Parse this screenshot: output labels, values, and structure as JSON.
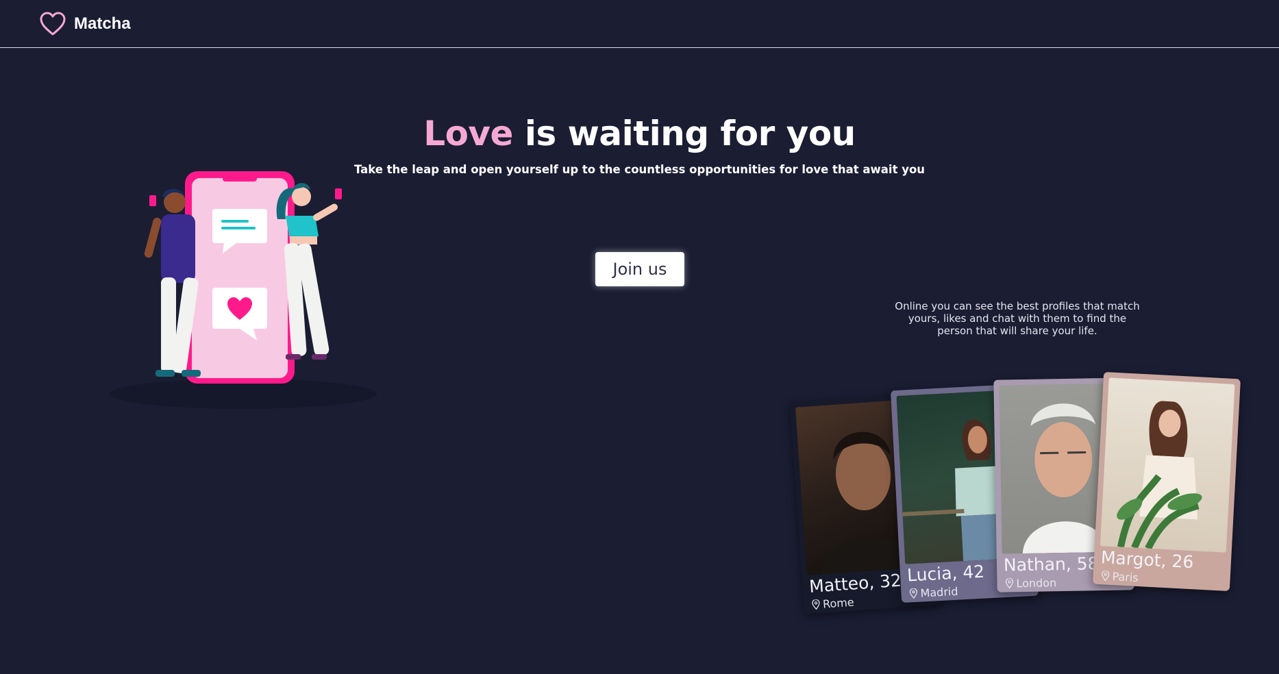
{
  "header": {
    "app_name": "Matcha",
    "logo_icon": "heart-outline-icon"
  },
  "hero": {
    "title_accent": "Love",
    "title_rest": " is waiting for you",
    "subtitle": "Take the leap and open yourself up to the countless opportunities for love that await you",
    "join_label": "Join us"
  },
  "side_text": "Online you can see the best profiles that match yours, likes and chat with them to find the person that will share your life.",
  "profiles": [
    {
      "name": "Matteo, 32",
      "city": "Rome"
    },
    {
      "name": "Lucia, 42",
      "city": "Madrid"
    },
    {
      "name": "Nathan, 58",
      "city": "London"
    },
    {
      "name": "Margot, 26",
      "city": "Paris"
    }
  ],
  "colors": {
    "background": "#1b1d33",
    "accent": "#f5a9d2",
    "phone_frame": "#ff1a8c",
    "button_bg": "#ffffff"
  }
}
